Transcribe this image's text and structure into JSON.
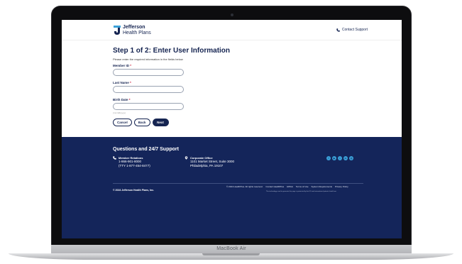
{
  "device": {
    "model_label": "MacBook Air"
  },
  "header": {
    "logo_line1": "Jefferson",
    "logo_line2": "Health Plans",
    "contact_label": "Contact Support"
  },
  "form": {
    "title": "Step 1 of 2: Enter User Information",
    "instructions": "Please enter the required information in the fields below",
    "member_id_label": "Member ID",
    "last_name_label": "Last Name",
    "birth_date_label": "Birth Date",
    "required_marker": "*",
    "birth_date_hint": "(mm/dd/yyyy)",
    "member_id_value": "",
    "last_name_value": "",
    "birth_date_value": "",
    "cancel_label": "Cancel",
    "back_label": "Back",
    "next_label": "Next"
  },
  "footer": {
    "title": "Questions and 24/7 Support",
    "member_relations": {
      "heading": "Member Relations",
      "phone": "1-866-901-8000",
      "tty": "(TTY 1-877-454-8477)"
    },
    "corporate_office": {
      "heading": "Corporate Office",
      "address1": "1101 Market Street, Suite 3000",
      "address2": "Philadelphia, PA 19107"
    },
    "social_icons": [
      "facebook-icon",
      "youtube-icon",
      "twitter-icon",
      "linkedin-icon",
      "instagram-icon"
    ],
    "copyright": "© 2024 Jefferson Health Plans, Inc.",
    "legal_links": [
      "© 2024 HealthPlus. All rights reserved.",
      "Contact HealthPlus",
      "HIPAA",
      "Terms of Use",
      "System Requirements",
      "Privacy Policy"
    ],
    "tech_note": "The technology used to generate this page is protected by the US and international patents listed here"
  },
  "colors": {
    "brand_navy": "#152451",
    "footer_bg": "#14255a",
    "social_blue": "#3aa0d8",
    "required_red": "#c8102e"
  }
}
